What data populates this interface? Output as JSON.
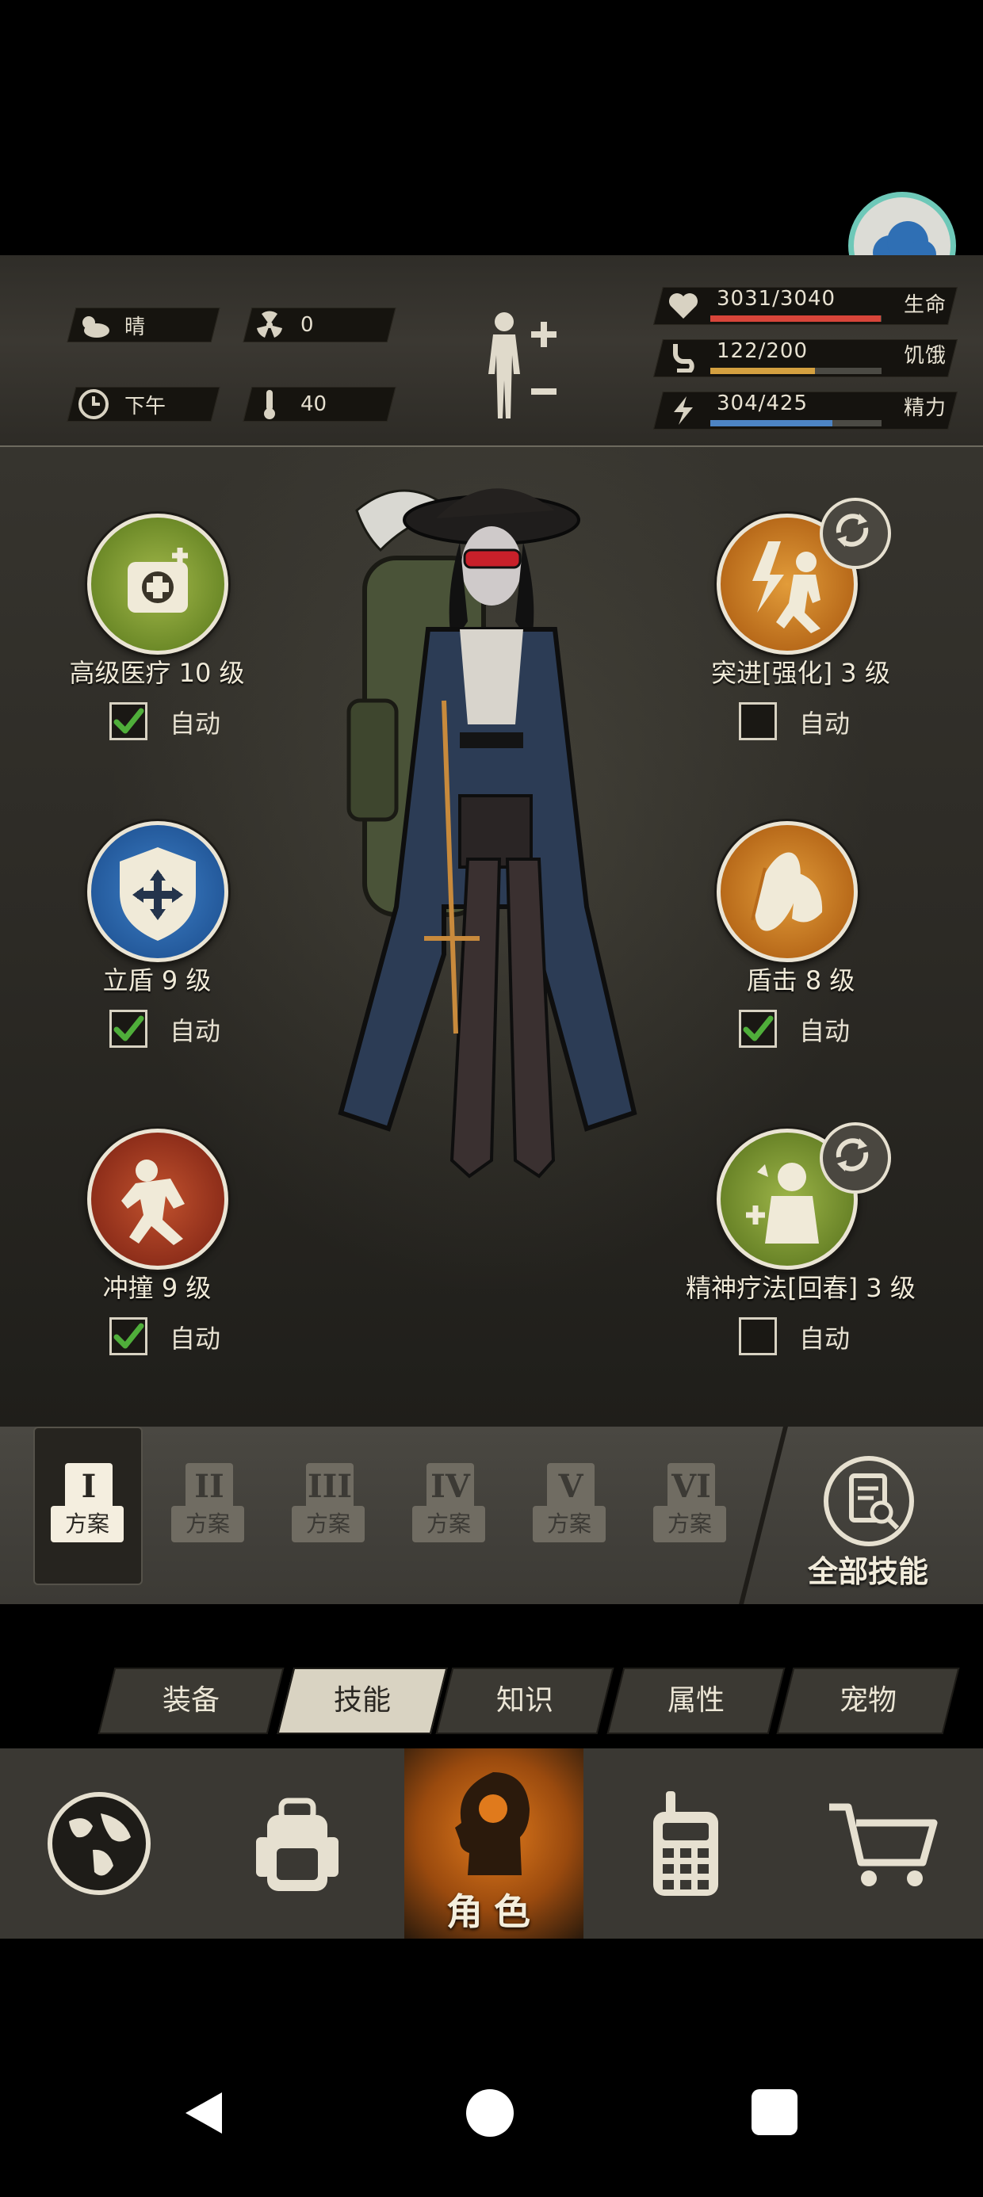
{
  "status": {
    "weather": "晴",
    "radiation": "0",
    "time_of_day": "下午",
    "temperature": "40",
    "health": {
      "value": "3031/3040",
      "label": "生命",
      "fraction": 0.997,
      "color": "#d8453a"
    },
    "hunger": {
      "value": "122/200",
      "label": "饥饿",
      "fraction": 0.61,
      "color": "#d4a040"
    },
    "energy": {
      "value": "304/425",
      "label": "精力",
      "fraction": 0.715,
      "color": "#4d84c4"
    }
  },
  "skills": {
    "left": [
      {
        "name": "高级医疗 10 级",
        "auto": true,
        "icon": "medical-kit-icon"
      },
      {
        "name": "立盾 9 级",
        "auto": true,
        "icon": "shield-icon"
      },
      {
        "name": "冲撞 9 级",
        "auto": true,
        "icon": "charge-icon"
      }
    ],
    "right": [
      {
        "name": "突进[强化] 3 级",
        "auto": false,
        "icon": "dash-icon"
      },
      {
        "name": "盾击 8 级",
        "auto": true,
        "icon": "shield-bash-icon"
      },
      {
        "name": "精神疗法[回春] 3 级",
        "auto": false,
        "icon": "psych-therapy-icon"
      }
    ],
    "auto_label": "自动"
  },
  "schemes": [
    {
      "numeral": "I",
      "label": "方案",
      "active": true
    },
    {
      "numeral": "II",
      "label": "方案",
      "active": false
    },
    {
      "numeral": "III",
      "label": "方案",
      "active": false
    },
    {
      "numeral": "IV",
      "label": "方案",
      "active": false
    },
    {
      "numeral": "V",
      "label": "方案",
      "active": false
    },
    {
      "numeral": "VI",
      "label": "方案",
      "active": false
    }
  ],
  "all_skills_label": "全部技能",
  "tabs": [
    {
      "label": "装备",
      "active": false
    },
    {
      "label": "技能",
      "active": true
    },
    {
      "label": "知识",
      "active": false
    },
    {
      "label": "属性",
      "active": false
    },
    {
      "label": "宠物",
      "active": false
    }
  ],
  "nav": {
    "items": [
      "globe-icon",
      "backpack-icon",
      "character-icon",
      "radio-icon",
      "cart-icon"
    ],
    "active_label": "角色"
  },
  "colors": {
    "accent_orange": "#e07a1c",
    "check_green": "#4fae3a",
    "cloud_blue": "#2f6fb4"
  }
}
